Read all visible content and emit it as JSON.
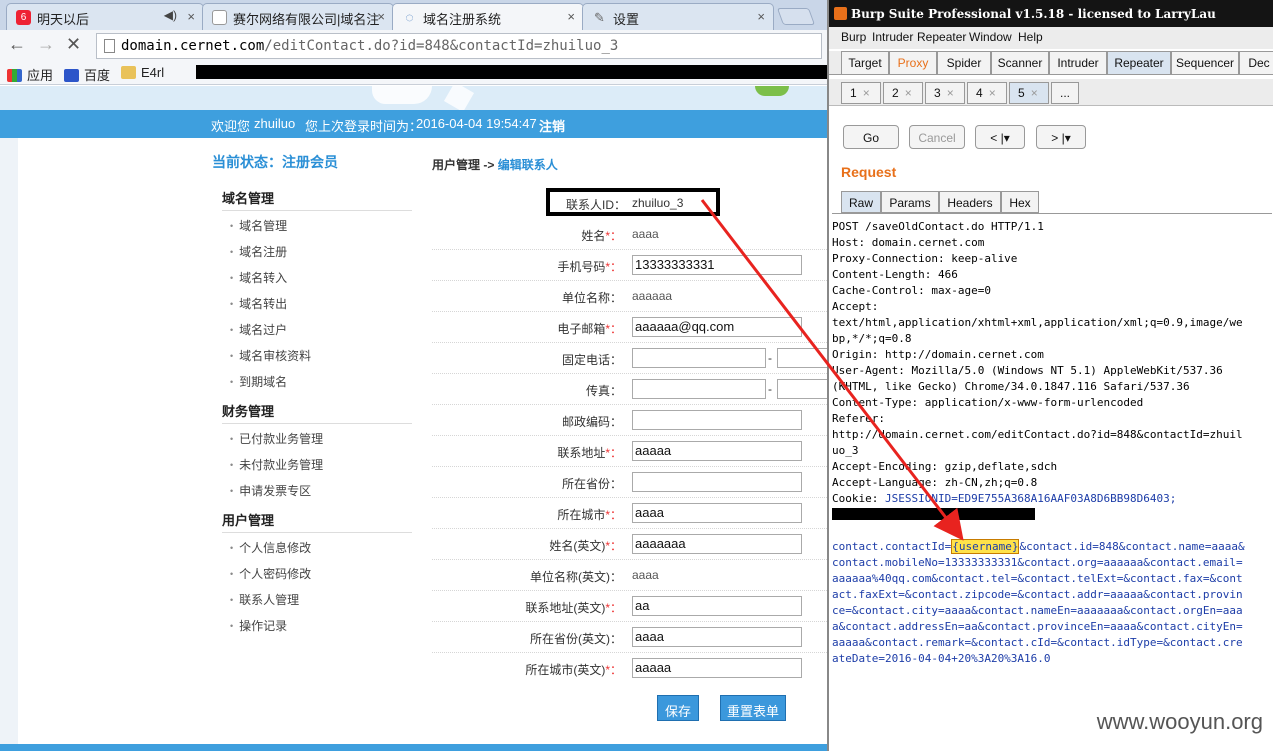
{
  "browser": {
    "tabs": [
      {
        "title": "明天以后",
        "icon": "6"
      },
      {
        "title": "赛尔网络有限公司|域名注",
        "icon": ""
      },
      {
        "title": "域名注册系统",
        "icon": ""
      },
      {
        "title": "设置",
        "icon": ""
      }
    ],
    "url_host": "domain.cernet.com",
    "url_path": "/editContact.do?id=848&contactId=zhuiluo_3",
    "bookmarks": [
      "应用",
      "百度",
      "E4rl"
    ]
  },
  "page": {
    "welcome": {
      "prefix": "欢迎您",
      "user": "zhuiluo",
      "last_login": "您上次登录时间为：",
      "time": "2016-04-04 19:54:47",
      "logout": "注销"
    },
    "status": "当前状态：注册会员",
    "sections": [
      {
        "title": "域名管理",
        "items": [
          "域名管理",
          "域名注册",
          "域名转入",
          "域名转出",
          "域名过户",
          "域名审核资料",
          "到期域名"
        ]
      },
      {
        "title": "财务管理",
        "items": [
          "已付款业务管理",
          "未付款业务管理",
          "申请发票专区"
        ]
      },
      {
        "title": "用户管理",
        "items": [
          "个人信息修改",
          "个人密码修改",
          "联系人管理",
          "操作记录"
        ]
      }
    ],
    "breadcrumb": {
      "parent": "用户管理",
      "sep": " ->",
      "current": " 编辑联系人"
    },
    "contact_id_label": "联系人ID：",
    "contact_id": "zhuiluo_3",
    "required_mark": "*：",
    "colon": "：",
    "dash": "-",
    "form": {
      "name": {
        "label": "姓名",
        "value": "aaaa"
      },
      "mobile": {
        "label": "手机号码",
        "value": "13333333331"
      },
      "org": {
        "label": "单位名称",
        "value": "aaaaaa"
      },
      "email": {
        "label": "电子邮箱",
        "value": "aaaaaa@qq.com"
      },
      "tel": {
        "label": "固定电话"
      },
      "fax": {
        "label": "传真"
      },
      "zipcode": {
        "label": "邮政编码"
      },
      "addr": {
        "label": "联系地址",
        "value": "aaaaa"
      },
      "province": {
        "label": "所在省份"
      },
      "city": {
        "label": "所在城市",
        "value": "aaaa"
      },
      "name_en": {
        "label": "姓名(英文)",
        "value": "aaaaaaa"
      },
      "org_en": {
        "label": "单位名称(英文)",
        "value": "aaaa"
      },
      "addr_en": {
        "label": "联系地址(英文)",
        "value": "aa"
      },
      "province_en": {
        "label": "所在省份(英文)",
        "value": "aaaa"
      },
      "city_en": {
        "label": "所在城市(英文)",
        "value": "aaaaa"
      }
    },
    "buttons": {
      "save": "保存",
      "reset": "重置表单"
    }
  },
  "burp": {
    "title": "Burp Suite Professional v1.5.18 - licensed to LarryLau",
    "menu": [
      "Burp",
      "Intruder",
      "Repeater",
      "Window",
      "Help"
    ],
    "tabs": [
      "Target",
      "Proxy",
      "Spider",
      "Scanner",
      "Intruder",
      "Repeater",
      "Sequencer",
      "Dec"
    ],
    "sub_tabs": [
      "1",
      "2",
      "3",
      "4",
      "5",
      "..."
    ],
    "tab_close": "×",
    "buttons": {
      "go": "Go",
      "cancel": "Cancel",
      "back": "< |▾",
      "forward": "> |▾"
    },
    "request_label": "Request",
    "req_tabs": [
      "Raw",
      "Params",
      "Headers",
      "Hex"
    ],
    "request_lines": [
      "POST /saveOldContact.do HTTP/1.1",
      "Host: domain.cernet.com",
      "Proxy-Connection: keep-alive",
      "Content-Length: 466",
      "Cache-Control: max-age=0",
      "Accept:",
      "text/html,application/xhtml+xml,application/xml;q=0.9,image/we",
      "bp,*/*;q=0.8",
      "Origin: http://domain.cernet.com",
      "User-Agent: Mozilla/5.0 (Windows NT 5.1) AppleWebKit/537.36",
      "(KHTML, like Gecko) Chrome/34.0.1847.116 Safari/537.36",
      "Content-Type: application/x-www-form-urlencoded",
      "Referer:",
      "http://domain.cernet.com/editContact.do?id=848&contactId=zhuil",
      "uo_3",
      "Accept-Encoding: gzip,deflate,sdch",
      "Accept-Language: zh-CN,zh;q=0.8"
    ],
    "cookie_label": "Cookie: ",
    "cookie_value": "JSESSIONID=ED9E755A368A16AAF03A8D6BB98D6403;",
    "body_prefix": "contact.contactId=",
    "body_highlight": "{username}",
    "body_rest": [
      "&contact.id=848&contact.name=aaaa&",
      "contact.mobileNo=13333333331&contact.org=aaaaaa&contact.email=",
      "aaaaaa%40qq.com&contact.tel=&contact.telExt=&contact.fax=&cont",
      "act.faxExt=&contact.zipcode=&contact.addr=aaaaa&contact.provin",
      "ce=&contact.city=aaaa&contact.nameEn=aaaaaaa&contact.orgEn=aaa",
      "a&contact.addressEn=aa&contact.provinceEn=aaaa&contact.cityEn=",
      "aaaaa&contact.remark=&contact.cId=&contact.idType=&contact.cre",
      "ateDate=2016-04-04+20%3A20%3A16.0"
    ]
  },
  "watermark": "www.wooyun.org"
}
